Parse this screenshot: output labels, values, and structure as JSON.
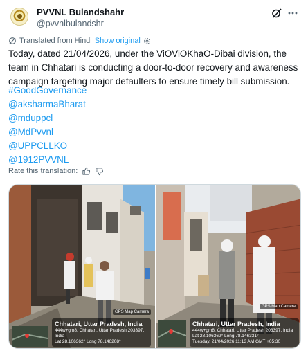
{
  "account": {
    "name": "PVVNL Bulandshahr",
    "handle": "@pvvnlbulandshr"
  },
  "icons": {
    "grok": "grok-slash-icon",
    "more": "more-horizontal-icon",
    "translate": "translate-icon",
    "settings": "gear-icon",
    "thumbs_up": "thumbs-up-icon",
    "thumbs_down": "thumbs-down-icon"
  },
  "translation": {
    "label": "Translated from Hindi",
    "show_original": "Show original"
  },
  "tweet": {
    "text": "Today, dated 21/04/2026, under the ViOViOKhaO-Dibai division, the team in Chhatari is conducting a door-to-door recovery and awareness campaign targeting major defaulters to ensure timely bill submission.",
    "hashtags": [
      "#GoodGovernance",
      "@aksharmaBharat",
      "@mduppcl",
      "@MdPvvnl",
      "@UPPCLLKO",
      "@1912PVVNL"
    ]
  },
  "rate": {
    "label": "Rate this translation:"
  },
  "photos": [
    {
      "camera_label": "GPS Map Camera",
      "place": "Chhatari, Uttar Pradesh, India",
      "address": "444w+gm8, Chhatari, Uttar Pradesh 203397, India",
      "latlong": "Lat 28.106362° Long 78.146208°"
    },
    {
      "camera_label": "GPS Map Camera",
      "place": "Chhatari, Uttar Pradesh, India",
      "address": "444w+gm8, Chhatari, Uttar Pradesh 203397, India",
      "latlong": "Lat 28.106362° Long 78.146331°",
      "timestamp": "Tuesday, 21/04/2026 11:13 AM GMT +05:30"
    }
  ],
  "colors": {
    "link": "#1d9bf0",
    "secondary_text": "#536471",
    "text": "#0f1419"
  }
}
